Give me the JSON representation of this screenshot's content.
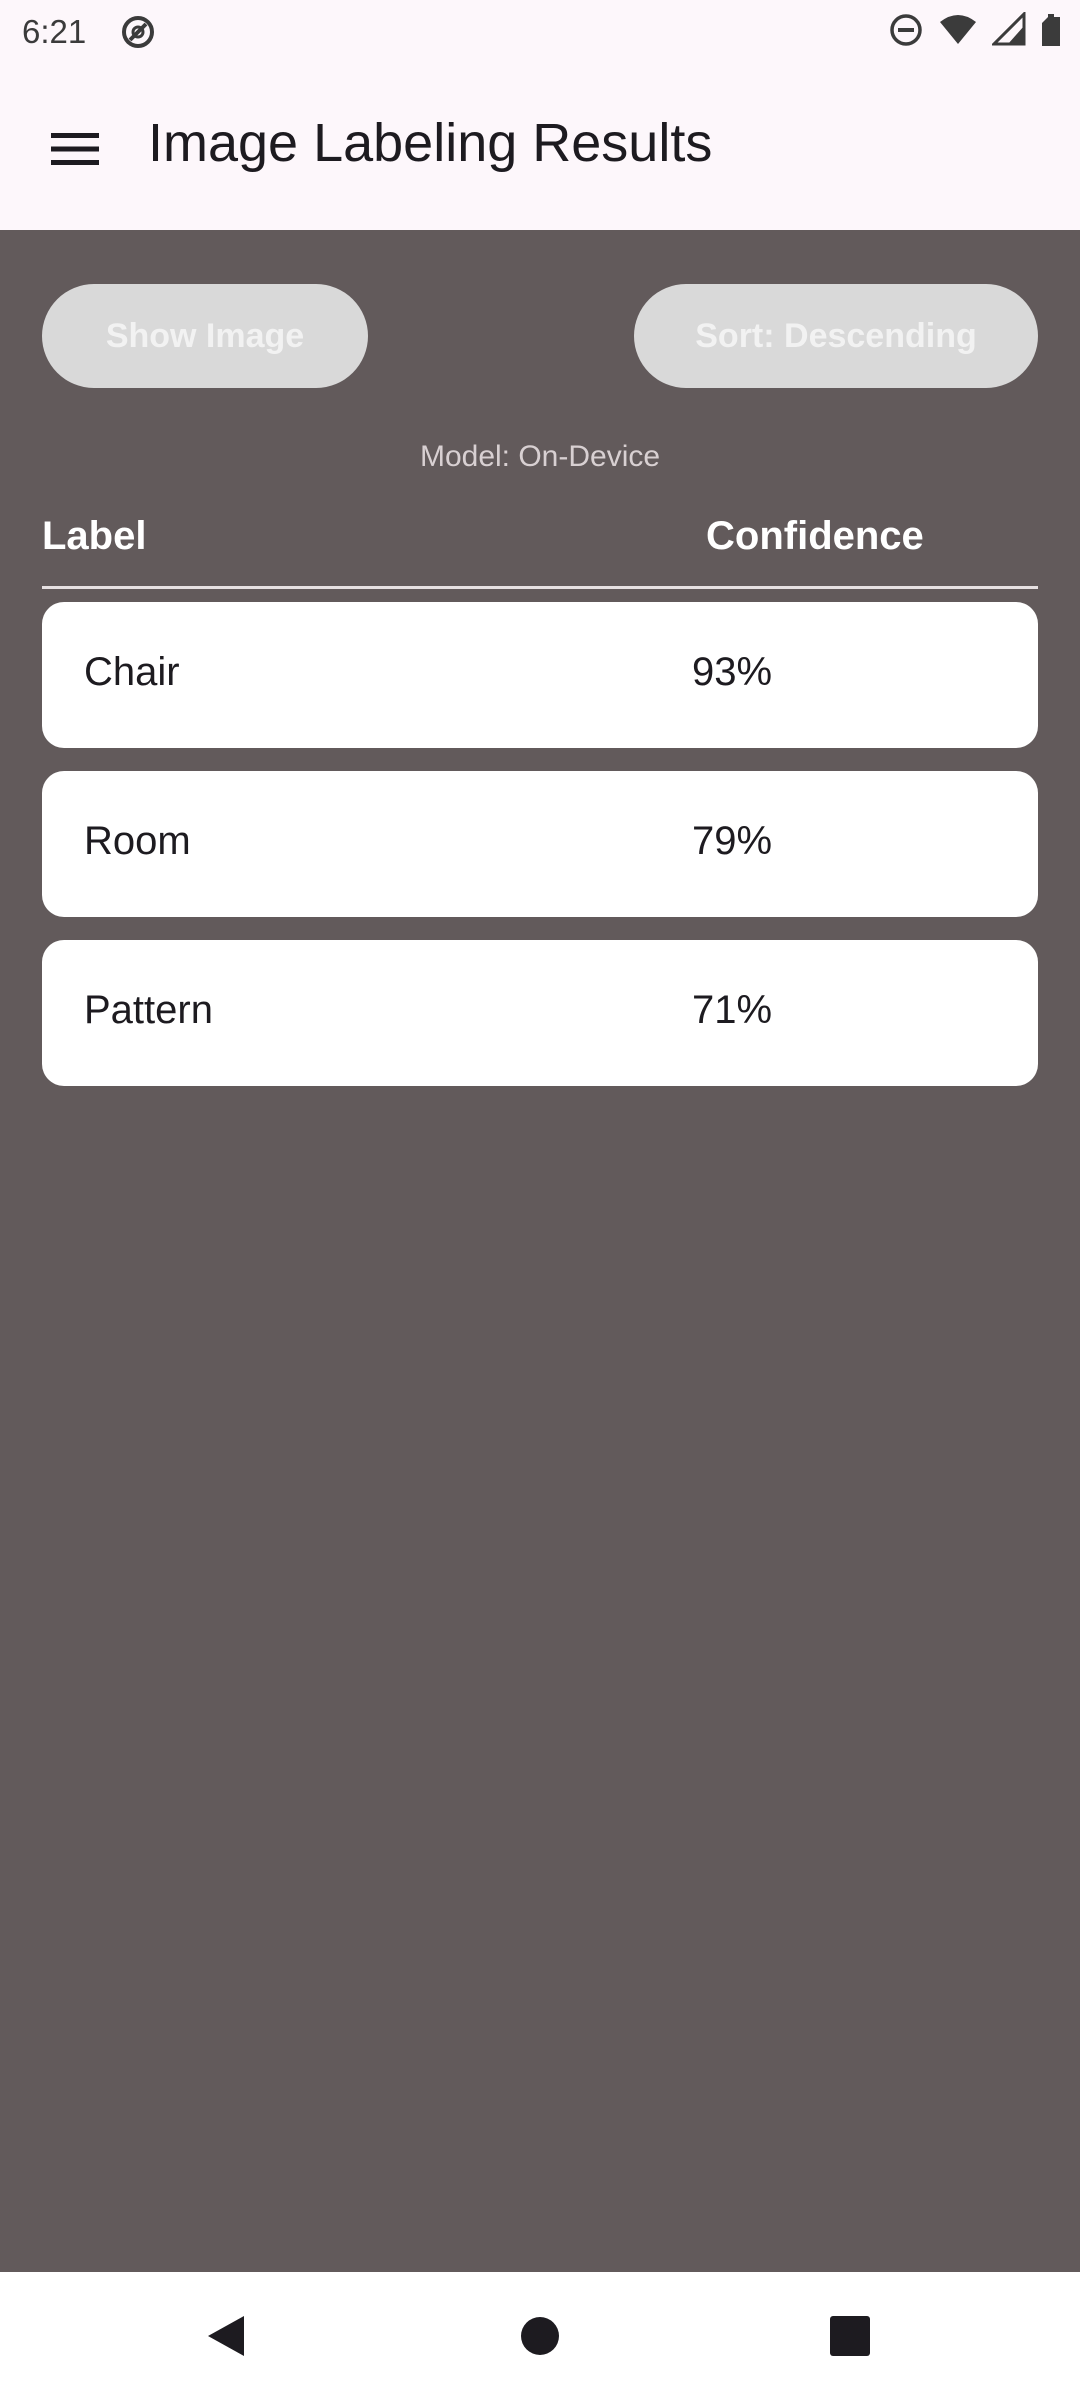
{
  "status_bar": {
    "time": "6:21",
    "left_icons": [
      "dnd-icon"
    ],
    "right_icons": [
      "do-not-disturb-icon",
      "wifi-icon",
      "signal-icon",
      "battery-icon"
    ]
  },
  "app_bar": {
    "menu_icon": "hamburger-menu-icon",
    "title": "Image Labeling Results"
  },
  "controls": {
    "show_image_label": "Show Image",
    "sort_label": "Sort: Descending",
    "model_text": "Model: On-Device"
  },
  "table": {
    "headers": {
      "label": "Label",
      "confidence": "Confidence"
    },
    "rows": [
      {
        "label": "Chair",
        "confidence": "93%"
      },
      {
        "label": "Room",
        "confidence": "79%"
      },
      {
        "label": "Pattern",
        "confidence": "71%"
      }
    ]
  },
  "nav_bar": {
    "icons": [
      "back-icon",
      "home-icon",
      "recents-icon"
    ]
  },
  "colors": {
    "background": "#625a5b",
    "app_bar": "#fdf7fb",
    "button_bg": "#d9d9d9",
    "row_bg": "#ffffff"
  }
}
